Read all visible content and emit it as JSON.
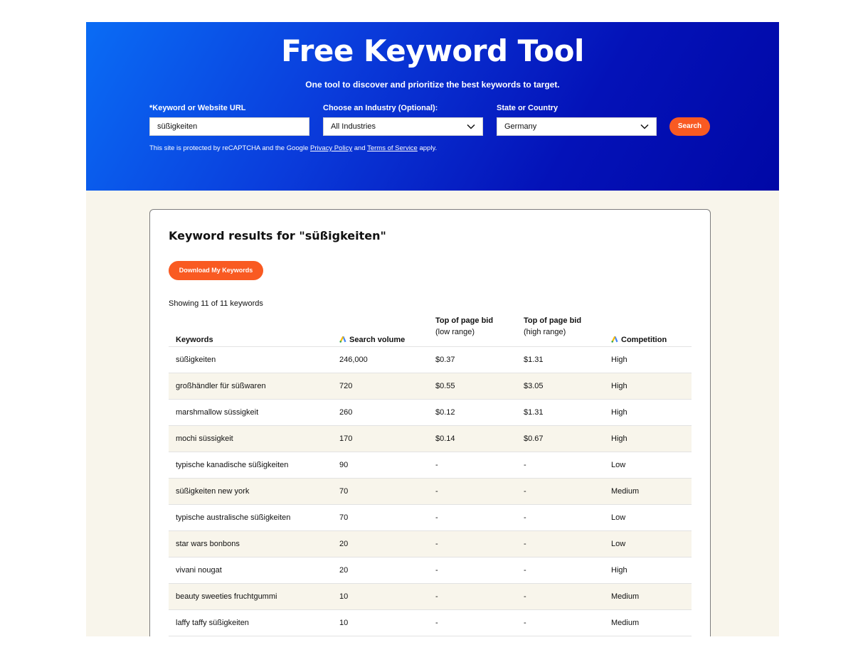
{
  "hero": {
    "title": "Free Keyword Tool",
    "subtitle": "One tool to discover and prioritize the best keywords to target."
  },
  "form": {
    "keyword_label": "*Keyword or Website URL",
    "keyword_value": "süßigkeiten",
    "industry_label": "Choose an Industry (Optional):",
    "industry_value": "All Industries",
    "location_label": "State or Country",
    "location_value": "Germany",
    "search_button": "Search",
    "recaptcha_prefix": "This site is protected by reCAPTCHA and the Google",
    "privacy_link": "Privacy Policy",
    "recaptcha_and": "and",
    "terms_link": "Terms of Service",
    "recaptcha_suffix": "apply."
  },
  "results": {
    "title": "Keyword results for \"süßigkeiten\"",
    "download_button": "Download My Keywords",
    "showing": "Showing 11 of 11 keywords",
    "columns": {
      "keywords": "Keywords",
      "volume": "Search volume",
      "low_bid_line1": "Top of page bid",
      "low_bid_line2": "(low range)",
      "high_bid_line1": "Top of page bid",
      "high_bid_line2": "(high range)",
      "competition": "Competition"
    },
    "rows": [
      {
        "keyword": "süßigkeiten",
        "volume": "246,000",
        "low": "$0.37",
        "high": "$1.31",
        "competition": "High"
      },
      {
        "keyword": "großhändler für süßwaren",
        "volume": "720",
        "low": "$0.55",
        "high": "$3.05",
        "competition": "High"
      },
      {
        "keyword": "marshmallow süssigkeit",
        "volume": "260",
        "low": "$0.12",
        "high": "$1.31",
        "competition": "High"
      },
      {
        "keyword": "mochi süssigkeit",
        "volume": "170",
        "low": "$0.14",
        "high": "$0.67",
        "competition": "High"
      },
      {
        "keyword": "typische kanadische süßigkeiten",
        "volume": "90",
        "low": "-",
        "high": "-",
        "competition": "Low"
      },
      {
        "keyword": "süßigkeiten new york",
        "volume": "70",
        "low": "-",
        "high": "-",
        "competition": "Medium"
      },
      {
        "keyword": "typische australische süßigkeiten",
        "volume": "70",
        "low": "-",
        "high": "-",
        "competition": "Low"
      },
      {
        "keyword": "star wars bonbons",
        "volume": "20",
        "low": "-",
        "high": "-",
        "competition": "Low"
      },
      {
        "keyword": "vivani nougat",
        "volume": "20",
        "low": "-",
        "high": "-",
        "competition": "High"
      },
      {
        "keyword": "beauty sweeties fruchtgummi",
        "volume": "10",
        "low": "-",
        "high": "-",
        "competition": "Medium"
      },
      {
        "keyword": "laffy taffy süßigkeiten",
        "volume": "10",
        "low": "-",
        "high": "-",
        "competition": "Medium"
      }
    ]
  },
  "colors": {
    "hero_gradient_start": "#0a6cf5",
    "hero_gradient_end": "#0008a6",
    "accent_orange": "#f95a22",
    "page_background": "#f8f5eb"
  },
  "icons": {
    "dropdown": "chevron-down-icon",
    "column_source": "google-ads-icon"
  }
}
